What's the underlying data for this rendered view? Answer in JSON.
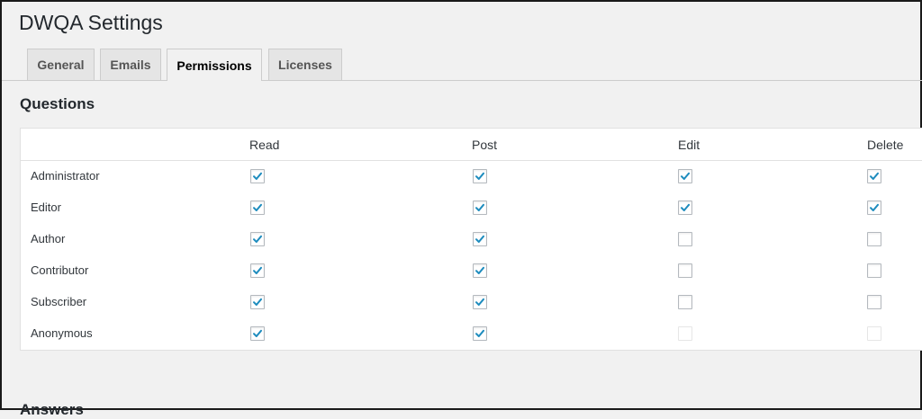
{
  "page": {
    "title": "DWQA Settings"
  },
  "tabs": [
    {
      "label": "General",
      "active": false
    },
    {
      "label": "Emails",
      "active": false
    },
    {
      "label": "Permissions",
      "active": true
    },
    {
      "label": "Licenses",
      "active": false
    }
  ],
  "questions": {
    "title": "Questions",
    "columns": [
      "Read",
      "Post",
      "Edit",
      "Delete"
    ],
    "rows": [
      {
        "role": "Administrator",
        "values": [
          "checked",
          "checked",
          "checked",
          "checked"
        ]
      },
      {
        "role": "Editor",
        "values": [
          "checked",
          "checked",
          "checked",
          "checked"
        ]
      },
      {
        "role": "Author",
        "values": [
          "checked",
          "checked",
          "unchecked",
          "unchecked"
        ]
      },
      {
        "role": "Contributor",
        "values": [
          "checked",
          "checked",
          "unchecked",
          "unchecked"
        ]
      },
      {
        "role": "Subscriber",
        "values": [
          "checked",
          "checked",
          "unchecked",
          "unchecked"
        ]
      },
      {
        "role": "Anonymous",
        "values": [
          "checked",
          "checked",
          "disabled",
          "disabled"
        ]
      }
    ]
  },
  "answers": {
    "title": "Answers"
  },
  "colors": {
    "checkmark": "#1e8cbe",
    "active_tab_bg": "#f1f1f1",
    "tab_bg": "#e5e5e5"
  }
}
